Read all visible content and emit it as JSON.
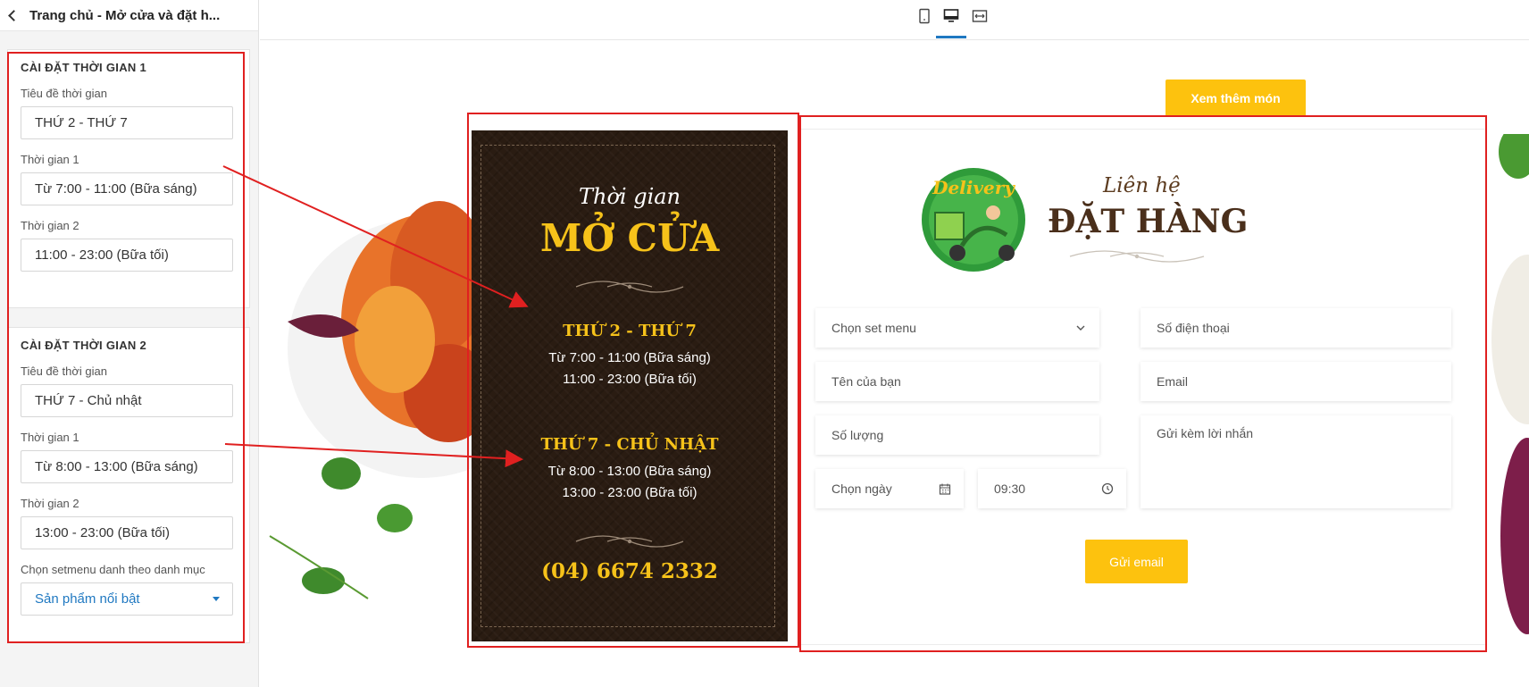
{
  "sidebar": {
    "header_title": "Trang chủ - Mở cửa và đặt h...",
    "section1": {
      "heading": "CÀI ĐẶT THỜI GIAN 1",
      "title_label": "Tiêu đề thời gian",
      "title_value": "THỨ 2 - THỨ 7",
      "time1_label": "Thời gian 1",
      "time1_value": "Từ 7:00 - 11:00 (Bữa sáng)",
      "time2_label": "Thời gian 2",
      "time2_value": "11:00 - 23:00 (Bữa tối)"
    },
    "section2": {
      "heading": "CÀI ĐẶT THỜI GIAN 2",
      "title_label": "Tiêu đề thời gian",
      "title_value": "THỨ 7 - Chủ nhật",
      "time1_label": "Thời gian 1",
      "time1_value": "Từ 8:00 - 13:00 (Bữa sáng)",
      "time2_label": "Thời gian 2",
      "time2_value": "13:00 - 23:00 (Bữa tối)",
      "category_label": "Chọn setmenu danh theo danh mục",
      "category_value": "Sản phẩm nổi bật"
    }
  },
  "toolbar": {
    "icons": [
      "mobile-view-icon",
      "desktop-view-icon",
      "fullwidth-view-icon"
    ],
    "active": "desktop-view-icon"
  },
  "preview": {
    "more_button": "Xem thêm món",
    "hours": {
      "script_title": "Thời gian",
      "big_title": "MỞ CỬA",
      "day1": "THỨ 2 - THỨ 7",
      "day1_time1": "Từ 7:00 - 11:00 (Bữa sáng)",
      "day1_time2": "11:00 - 23:00 (Bữa tối)",
      "day2": "THỨ 7 - CHỦ NHẬT",
      "day2_time1": "Từ 8:00 - 13:00 (Bữa sáng)",
      "day2_time2": "13:00 - 23:00 (Bữa tối)",
      "phone": "(04) 6674 2332"
    },
    "order": {
      "logo_text": "Delivery",
      "script_title": "Liên hệ",
      "big_title": "ĐẶT HÀNG",
      "set_menu_placeholder": "Chọn set menu",
      "phone_placeholder": "Số điện thoại",
      "name_placeholder": "Tên của bạn",
      "email_placeholder": "Email",
      "qty_placeholder": "Số lượng",
      "message_placeholder": "Gửi kèm lời nhắn",
      "date_placeholder": "Chọn ngày",
      "time_value": "09:30",
      "send_button": "Gửi email"
    }
  },
  "colors": {
    "accent_yellow": "#fdc20e",
    "hours_bg": "#2a1c12",
    "annotation_red": "#e02020",
    "select_blue": "#1f78c1"
  }
}
